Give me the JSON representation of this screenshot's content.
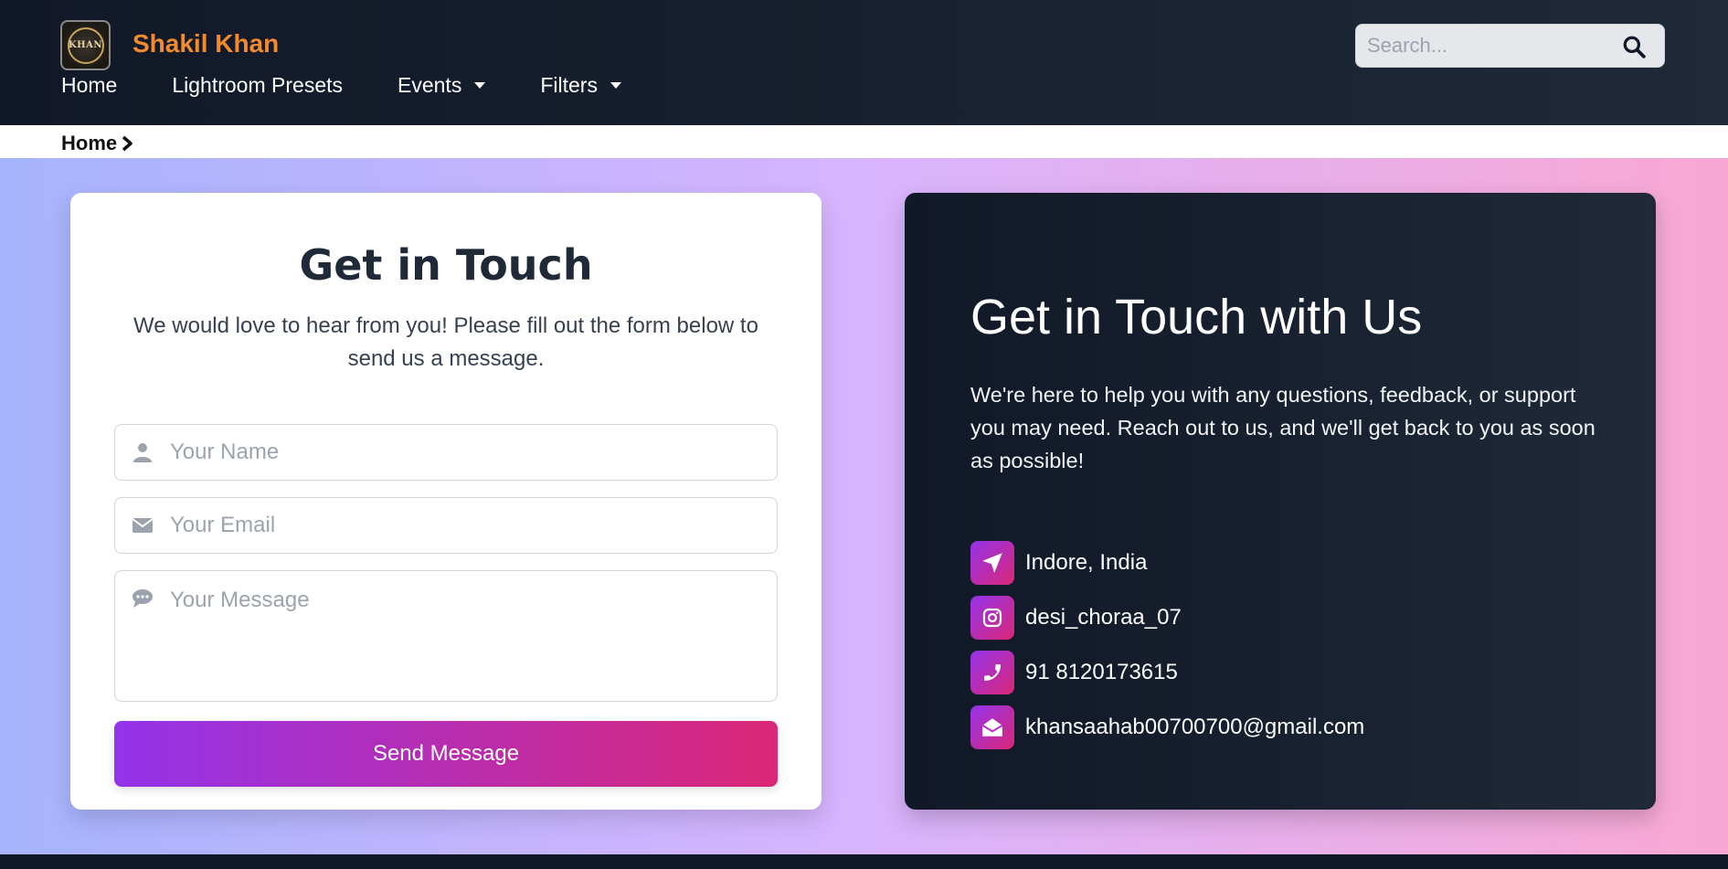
{
  "brand": {
    "name": "Shakil Khan",
    "logo_text": "KHAN",
    "name_color": "#f28b30"
  },
  "nav": {
    "items": [
      {
        "label": "Home",
        "dropdown": false
      },
      {
        "label": "Lightroom Presets",
        "dropdown": false
      },
      {
        "label": "Events",
        "dropdown": true
      },
      {
        "label": "Filters",
        "dropdown": true
      }
    ],
    "search": {
      "placeholder": "Search...",
      "icon": "search-icon"
    }
  },
  "breadcrumb": {
    "items": [
      "Home"
    ]
  },
  "form": {
    "title": "Get in Touch",
    "subtitle": "We would love to hear from you! Please fill out the form below to send us a message.",
    "name_placeholder": "Your Name",
    "email_placeholder": "Your Email",
    "message_placeholder": "Your Message",
    "submit_label": "Send Message"
  },
  "info": {
    "title": "Get in Touch with Us",
    "text": "We're here to help you with any questions, feedback, or support you may need. Reach out to us, and we'll get back to you as soon as possible!",
    "items": [
      {
        "icon": "location-arrow-icon",
        "label": "Indore, India"
      },
      {
        "icon": "instagram-icon",
        "label": "desi_choraa_07"
      },
      {
        "icon": "phone-icon",
        "label": "91 8120173615"
      },
      {
        "icon": "envelope-open-icon",
        "label": "khansaahab00700700@gmail.com"
      }
    ]
  },
  "colors": {
    "navbar": "#111827",
    "accent_start": "#9333ea",
    "accent_end": "#db2777",
    "bg_gradient": [
      "#a5b4fc",
      "#d8b4fe",
      "#f9a8d4"
    ]
  }
}
